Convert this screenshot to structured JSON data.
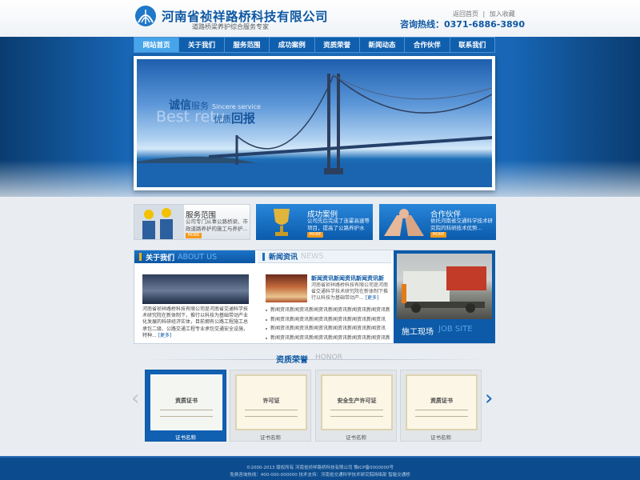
{
  "header": {
    "company_name": "河南省祯祥路桥科技有限公司",
    "slogan": "道路桥梁养护综合服务专家",
    "links": [
      "返回首页",
      "加入收藏"
    ],
    "hotline": "咨询热线：0371-6886-3890"
  },
  "nav": {
    "items": [
      "网站首页",
      "关于我们",
      "服务范围",
      "成功案例",
      "资质荣誉",
      "新闻动态",
      "合作伙伴",
      "联系我们"
    ],
    "active_index": 0
  },
  "banner": {
    "slogan_main": "诚信",
    "slogan_sub": "服务",
    "slogan_en": "Sincere service",
    "best_text": "Best retu",
    "slogan2_sub": "优质",
    "slogan2_main": "回报"
  },
  "promos": [
    {
      "title": "服务范围",
      "desc": "公司专门从事公路桥梁、市政道路养护的施工与养护...",
      "more": "MORE"
    },
    {
      "title": "成功案例",
      "desc": "公司先后完成了连霍高速等项目，提高了公路养护水平...",
      "more": "MORE"
    },
    {
      "title": "合作伙伴",
      "desc": "依托河南省交通科学技术研究院的科研技术优势...",
      "more": "MORE"
    }
  ],
  "about": {
    "title": "关于我们",
    "title_en": "ABOUT US",
    "text": "河南省祯祥路桥科技有限公司是河南省交通科学技术研究院在新体制下，推行以科技为基础带动产业化发展的科研经济实体，目前拥有公路工程施工总承包二级、公路交通工程专业承包交通安全设施，特种...",
    "more": "[更多]"
  },
  "news": {
    "title": "新闻资讯",
    "title_en": "NEWS",
    "feature_title": "新闻资讯新闻资讯新闻资讯新",
    "feature_text": "河南省祯祥路桥科技有限公司是河南省交通科学技术研究院在新体制下推行以科技为基础带动产...",
    "feature_more": "[更多]",
    "items": [
      "新闻资讯新闻资讯新闻资讯新闻资讯新闻资讯新闻资讯新闻",
      "新闻资讯新闻资讯新闻资讯新闻资讯新闻资讯新闻资讯",
      "新闻资讯新闻资讯新闻资讯新闻资讯新闻资讯新闻资讯",
      "新闻资讯新闻资讯新闻资讯新闻资讯新闻资讯新闻资讯新闻"
    ]
  },
  "site": {
    "title": "施工现场",
    "title_en": "JOB SITE"
  },
  "honor": {
    "title": "资质荣誉",
    "title_en": "HONOR",
    "certs": [
      {
        "label": "证书名称",
        "doc_title": "资质证书"
      },
      {
        "label": "证书名称",
        "doc_title": "许可证"
      },
      {
        "label": "证书名称",
        "doc_title": "安全生产许可证"
      },
      {
        "label": "证书名称",
        "doc_title": "资质证书"
      }
    ],
    "active_index": 0
  },
  "footer": {
    "line1": "©2000-2013 版权所有 河南省祯祥路桥科技有限公司 豫ICP备0000000号",
    "line2": "免费咨询热线：400-000-000000   技术支持：河南省交通科学技术研究院网络部 智能交通桥"
  },
  "colors": {
    "brand_blue": "#0e58a3",
    "nav_active": "#46a4ea",
    "accent_orange": "#f39a1a"
  }
}
